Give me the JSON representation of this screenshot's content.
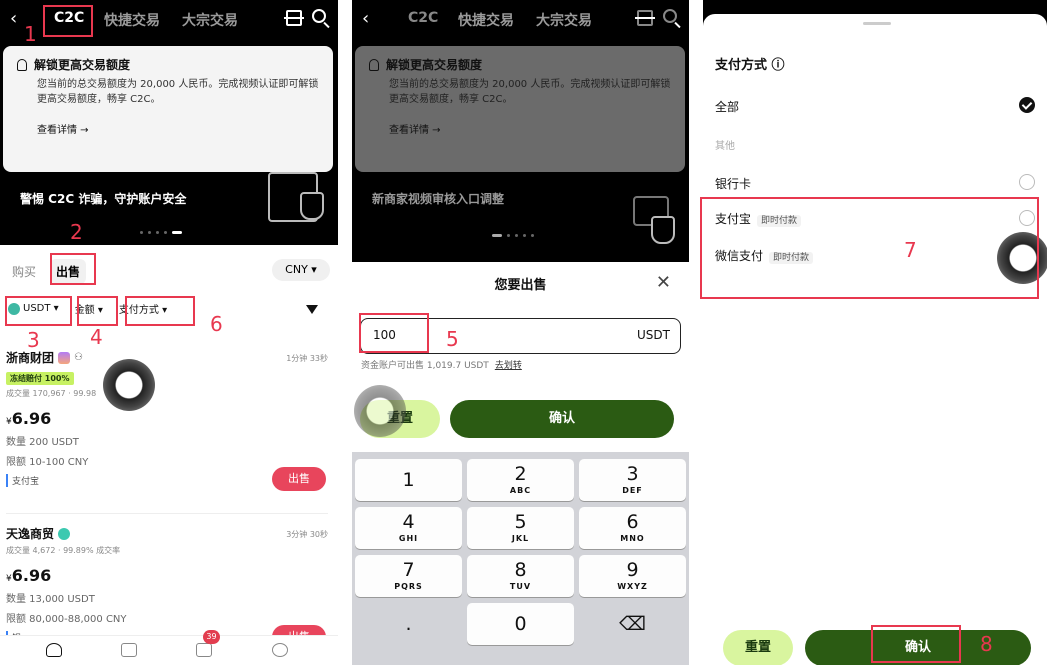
{
  "nav": {
    "tabs": [
      "C2C",
      "快捷交易",
      "大宗交易"
    ]
  },
  "tip": {
    "title": "解锁更高交易额度",
    "desc": "您当前的总交易额度为 20,000 人民币。完成视频认证即可解锁更高交易额度，畅享 C2C。",
    "more": "查看详情 →"
  },
  "banner": {
    "text1": "警惕 C2C 诈骗，守护账户安全",
    "text2": "新商家视频审核入口调整"
  },
  "list": {
    "seg_buy": "购买",
    "seg_sell": "出售",
    "currency": "CNY ▾",
    "filter_coin": "USDT ▾",
    "filter_amount": "金额 ▾",
    "filter_pay": "支付方式 ▾",
    "offers": [
      {
        "name": "浙商财团",
        "time": "1分钟 33秒",
        "tag": "冻结赔付 100%",
        "stat": "成交量 170,967 · 99.98",
        "currency_sign": "¥",
        "price": "6.96",
        "qty": "数量 200 USDT",
        "limit": "限额 10-100 CNY",
        "pay": "支付宝",
        "btn": "出售"
      },
      {
        "name": "天逸商贸",
        "time": "3分钟 30秒",
        "stat": "成交量 4,672 · 99.89% 成交率",
        "currency_sign": "¥",
        "price": "6.96",
        "qty": "数量 13,000 USDT",
        "limit": "限额 80,000-88,000 CNY",
        "pay": "银",
        "btn": "出售"
      }
    ],
    "msg_badge": "39"
  },
  "sell_sheet": {
    "title": "您要出售",
    "close": "✕",
    "amount": "100",
    "unit": "USDT",
    "available": "资金账户可出售 1,019.7 USDT",
    "transfer": "去划转",
    "reset": "重置",
    "confirm": "确认"
  },
  "keypad": [
    {
      "num": "1",
      "letters": ""
    },
    {
      "num": "2",
      "letters": "ABC"
    },
    {
      "num": "3",
      "letters": "DEF"
    },
    {
      "num": "4",
      "letters": "GHI"
    },
    {
      "num": "5",
      "letters": "JKL"
    },
    {
      "num": "6",
      "letters": "MNO"
    },
    {
      "num": "7",
      "letters": "PQRS"
    },
    {
      "num": "8",
      "letters": "TUV"
    },
    {
      "num": "9",
      "letters": "WXYZ"
    },
    {
      "num": ".",
      "letters": ""
    },
    {
      "num": "0",
      "letters": ""
    },
    {
      "num": "⌫",
      "letters": ""
    }
  ],
  "pay_sheet": {
    "title": "支付方式 ⓘ",
    "all": "全部",
    "other": "其他",
    "bank": "银行卡",
    "alipay": "支付宝",
    "alipay_sub": "即时付款",
    "wechat": "微信支付",
    "wechat_sub": "即时付款",
    "reset": "重置",
    "confirm": "确认"
  },
  "steps": [
    "1",
    "2",
    "3",
    "4",
    "5",
    "6",
    "7",
    "8"
  ],
  "colors": {
    "sell_red": "#e8455c",
    "confirm_green": "#2b5b13",
    "reset_lime": "#d9f59f",
    "annotation_red": "#e8384f"
  }
}
